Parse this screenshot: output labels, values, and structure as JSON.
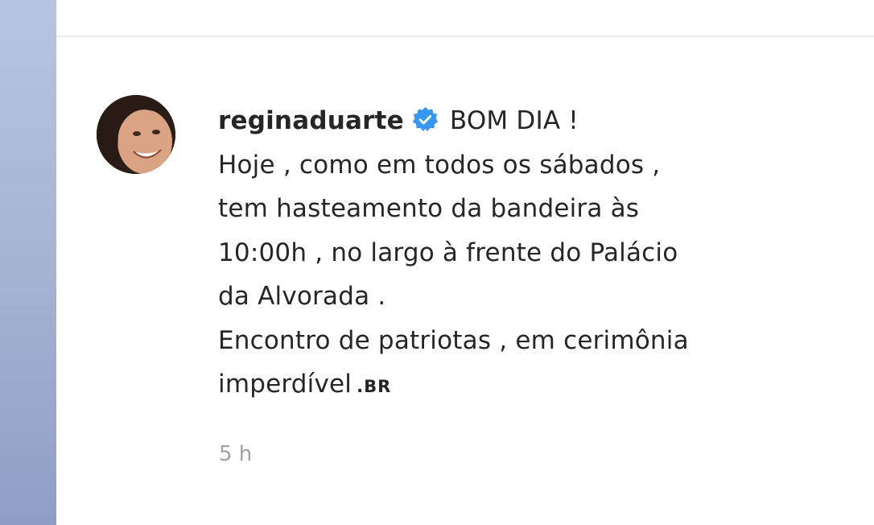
{
  "comment": {
    "username": "reginaduarte",
    "verified_icon": "verified-badge-icon",
    "caption_lines": [
      "BOM DIA !",
      "Hoje , como em todos os sábados ,",
      "tem hasteamento da bandeira às",
      "10:00h , no largo à frente do Palácio",
      "da Alvorada .",
      "Encontro de patriotas , em cerimônia",
      "imperdível"
    ],
    "flag_label": ".BR",
    "timestamp": "5 h"
  },
  "colors": {
    "text": "#262626",
    "timestamp": "#a0a0a0",
    "verified_blue": "#3897f0",
    "sidebar": "#a5b4d3"
  }
}
